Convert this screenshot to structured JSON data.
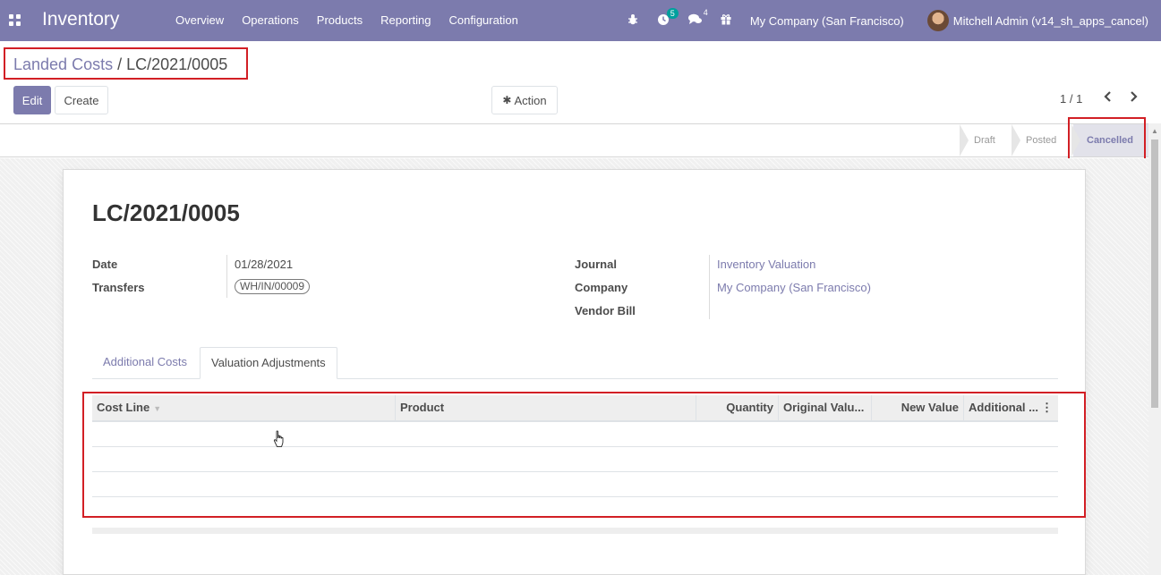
{
  "navbar": {
    "app_name": "Inventory",
    "menu": [
      "Overview",
      "Operations",
      "Products",
      "Reporting",
      "Configuration"
    ],
    "activity_count": "5",
    "messages_count": "4",
    "company": "My Company (San Francisco)",
    "user": "Mitchell Admin (v14_sh_apps_cancel)"
  },
  "breadcrumb": {
    "parent": "Landed Costs",
    "separator": "/",
    "current": "LC/2021/0005"
  },
  "buttons": {
    "edit": "Edit",
    "create": "Create",
    "action": "Action"
  },
  "pager": {
    "value": "1 / 1"
  },
  "statusbar": {
    "stages": [
      "Draft",
      "Posted",
      "Cancelled"
    ],
    "active": "Cancelled"
  },
  "record": {
    "title": "LC/2021/0005",
    "fields": {
      "date_label": "Date",
      "date_value": "01/28/2021",
      "transfers_label": "Transfers",
      "transfers_value": "WH/IN/00009",
      "journal_label": "Journal",
      "journal_value": "Inventory Valuation",
      "company_label": "Company",
      "company_value": "My Company (San Francisco)",
      "vendor_bill_label": "Vendor Bill",
      "vendor_bill_value": ""
    }
  },
  "tabs": {
    "items": [
      "Additional Costs",
      "Valuation Adjustments"
    ],
    "active": "Valuation Adjustments"
  },
  "table": {
    "columns": [
      "Cost Line",
      "Product",
      "Quantity",
      "Original Valu...",
      "New Value",
      "Additional ..."
    ],
    "rows": []
  },
  "colors": {
    "navbar": "#7c7bad",
    "accent": "#7c7bad",
    "highlight": "#d21f25"
  }
}
